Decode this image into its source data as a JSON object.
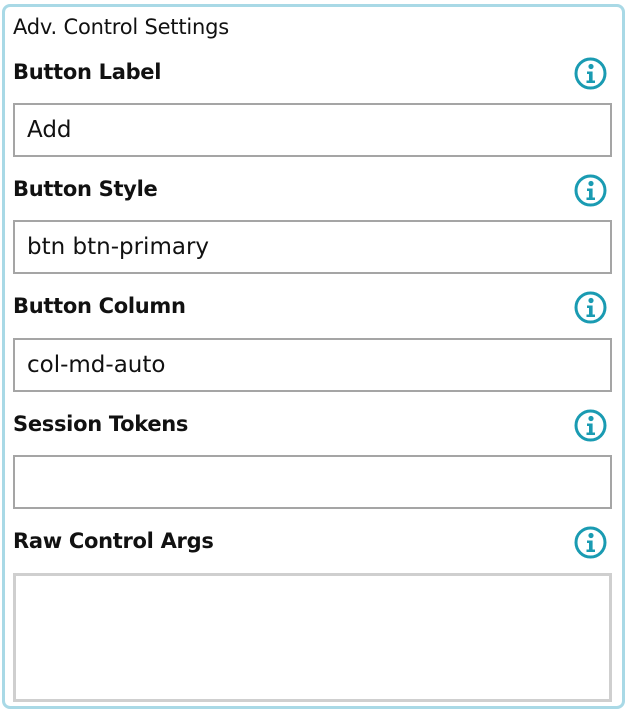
{
  "panel": {
    "title": "Adv. Control Settings",
    "accent_color": "#1a9bb2",
    "border_color": "#a9d9e6"
  },
  "fields": [
    {
      "label": "Button Label",
      "value": "Add",
      "info_icon": "info-circle-icon"
    },
    {
      "label": "Button Style",
      "value": "btn btn-primary",
      "info_icon": "info-circle-icon"
    },
    {
      "label": "Button Column",
      "value": "col-md-auto",
      "info_icon": "info-circle-icon"
    },
    {
      "label": "Session Tokens",
      "value": "",
      "info_icon": "info-circle-icon"
    },
    {
      "label": "Raw Control Args",
      "value": "",
      "info_icon": "info-circle-icon"
    }
  ]
}
